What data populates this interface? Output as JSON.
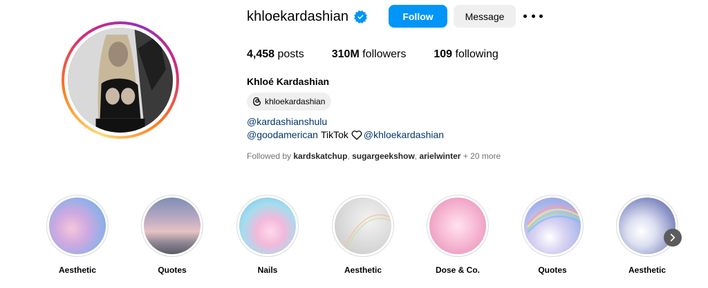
{
  "profile": {
    "username": "khloekardashian",
    "verified": true,
    "follow_label": "Follow",
    "message_label": "Message",
    "stats": {
      "posts_count": "4,458",
      "posts_label": "posts",
      "followers_count": "310M",
      "followers_label": "followers",
      "following_count": "109",
      "following_label": "following"
    },
    "full_name": "Khloé Kardashian",
    "threads_handle": "khloekardashian",
    "bio_line1": "@kardashianshulu",
    "bio_line2_link1": "@goodamerican",
    "bio_line2_text": "TikTok",
    "bio_line2_link2": "@khloekardashian",
    "followed_by_prefix": "Followed by",
    "followed_by_1": "kardskatchup",
    "followed_by_2": "sugargeekshow",
    "followed_by_3": "arielwinter",
    "followed_by_more": "+ 20 more"
  },
  "highlights": [
    {
      "label": "Aesthetic"
    },
    {
      "label": "Quotes"
    },
    {
      "label": "Nails"
    },
    {
      "label": "Aesthetic"
    },
    {
      "label": "Dose & Co."
    },
    {
      "label": "Quotes"
    },
    {
      "label": "Aesthetic"
    }
  ],
  "colors": {
    "accent": "#0095f6",
    "link": "#00376b",
    "muted": "#737373"
  }
}
